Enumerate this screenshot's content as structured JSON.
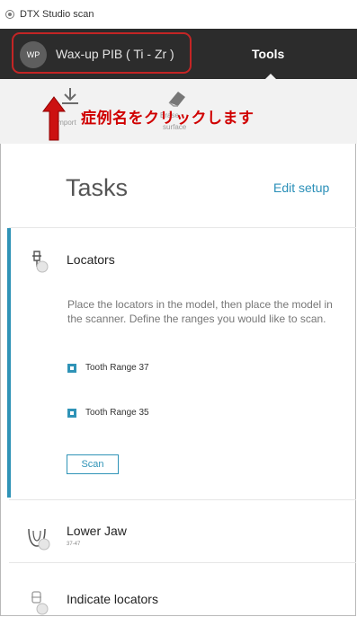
{
  "window": {
    "title": "DTX Studio scan"
  },
  "header": {
    "avatar_initials": "WP",
    "case_name": "Wax-up PIB ( Ti - Zr )",
    "tools_tab": "Tools"
  },
  "toolbar": {
    "import_label": "Import",
    "erase_label_top": "Erase",
    "erase_label_bottom": "surface"
  },
  "annotation": {
    "text": "症例名をクリックします",
    "color": "#d00000"
  },
  "tasks": {
    "heading": "Tasks",
    "edit_setup": "Edit setup",
    "items": [
      {
        "title": "Locators",
        "icon": "locator-icon",
        "description": "Place the locators in the model, then place the model in the scanner. Define the ranges you would like to scan.",
        "ranges": [
          "Tooth Range 37",
          "Tooth Range 35"
        ],
        "action": "Scan"
      },
      {
        "title": "Lower Jaw",
        "subtitle": "37-47",
        "icon": "lower-jaw-icon"
      },
      {
        "title": "Indicate locators",
        "icon": "indicate-locators-icon"
      }
    ]
  },
  "colors": {
    "accent": "#2f93b7",
    "topbar": "#2c2c2c",
    "highlight": "#c42525"
  }
}
